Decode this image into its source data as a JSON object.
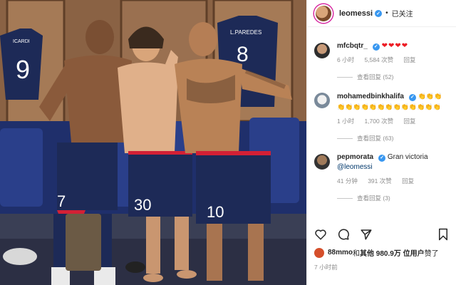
{
  "post": {
    "username": "leomessi",
    "separator": "•",
    "follow_status": "已关注",
    "comments": [
      {
        "user": "mfcbqtr_",
        "text": "❤❤❤❤",
        "time": "6 小时",
        "likes": "5,584 次赞",
        "reply": "回复",
        "view_replies": "查看回复 (52)"
      },
      {
        "user": "mohamedbinkhalifa",
        "text": "👏👏👏👏👏👏👏👏👏👏👏👏👏👏👏👏",
        "time": "1 小时",
        "likes": "1,700 次赞",
        "reply": "回复",
        "view_replies": "查看回复 (63)"
      },
      {
        "user": "pepmorata",
        "text": "Gran victoria",
        "mention": "@leomessi",
        "time": "41 分钟",
        "likes": "391 次赞",
        "reply": "回复",
        "view_replies": "查看回复 (3)"
      }
    ],
    "likes_user": "88mmo",
    "likes_mid": " 和 ",
    "likes_others": "其他 980.9万 位用户",
    "likes_suffix": " 赞了",
    "timestamp": "7 小时前"
  },
  "photo": {
    "jersey_icardi_name": "ICARDI",
    "jersey_icardi_number": "9",
    "jersey_paredes_name": "L.PAREDES",
    "jersey_paredes_number": "8",
    "shorts_numbers": [
      "7",
      "30",
      "10"
    ]
  },
  "colors": {
    "psg_navy": "#1d2a57",
    "psg_red": "#d32035",
    "verified_blue": "#3897f0",
    "heart_red": "#ed1c24"
  },
  "icons": [
    "verified-icon",
    "heart-icon",
    "comment-icon",
    "share-icon",
    "bookmark-icon"
  ]
}
